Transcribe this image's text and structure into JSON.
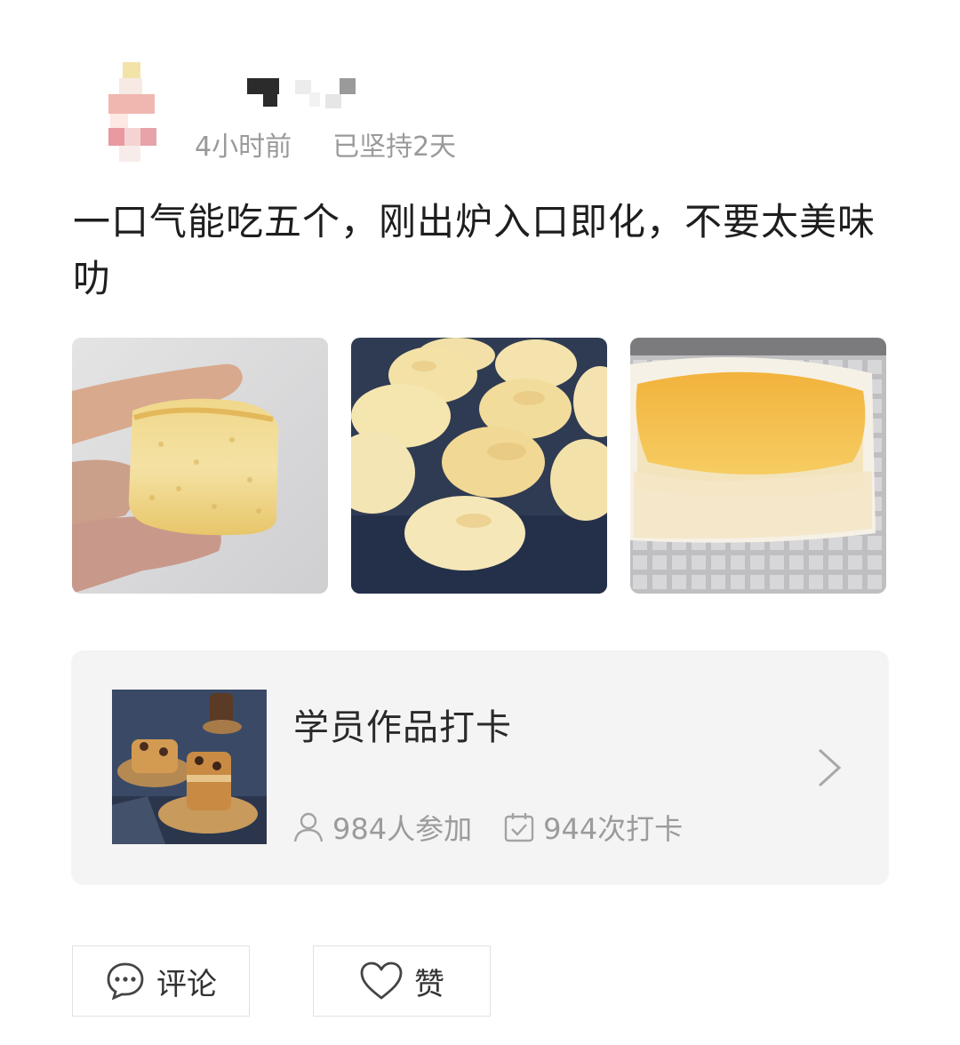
{
  "post": {
    "time_ago": "4小时前",
    "streak": "已坚持2天",
    "text": "一口气能吃五个，刚出炉入口即化，不要太美味叻"
  },
  "photos": [
    {
      "alt": "hand holding a piece of sponge cake"
    },
    {
      "alt": "tray of baked oval cheesecakes"
    },
    {
      "alt": "single oval cheesecake in paper mold"
    }
  ],
  "course_card": {
    "title": "学员作品打卡",
    "participants": "984人参加",
    "checkins": "944次打卡",
    "icons": [
      "person-icon",
      "calendar-check-icon",
      "chevron-right-icon"
    ]
  },
  "actions": {
    "comment_label": "评论",
    "like_label": "赞",
    "icons": [
      "comment-icon",
      "heart-icon"
    ]
  },
  "colors": {
    "meta_text": "#9a9a9a",
    "card_bg": "#f4f4f4",
    "body_text": "#1e1e1e"
  }
}
